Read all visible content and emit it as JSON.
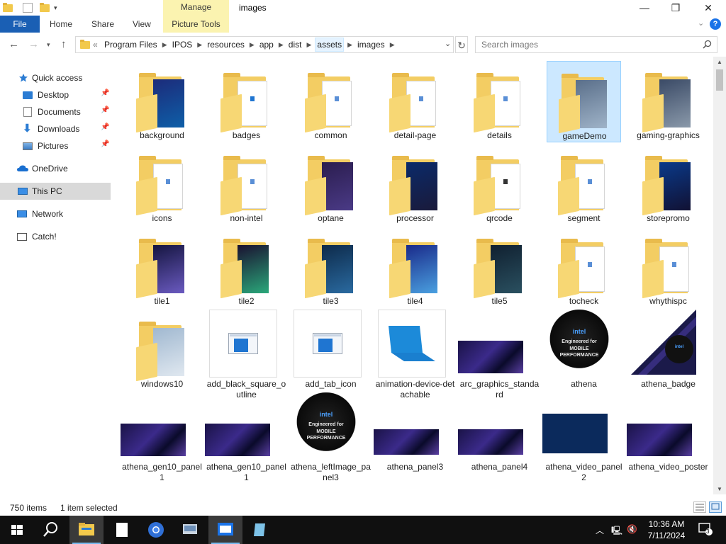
{
  "window": {
    "title": "images",
    "context_tab": "Manage",
    "minimize": "—",
    "maximize": "❐",
    "close": "✕"
  },
  "ribbon": {
    "file": "File",
    "tabs": [
      "Home",
      "Share",
      "View"
    ],
    "picture_tools": "Picture Tools"
  },
  "address": {
    "overflow": "«",
    "crumbs": [
      "Program Files",
      "IPOS",
      "resources",
      "app",
      "dist",
      "assets",
      "images"
    ],
    "highlighted_crumb": "assets"
  },
  "search": {
    "placeholder": "Search images"
  },
  "nav": {
    "quick_access": "Quick access",
    "desktop": "Desktop",
    "documents": "Documents",
    "downloads": "Downloads",
    "pictures": "Pictures",
    "onedrive": "OneDrive",
    "this_pc": "This PC",
    "network": "Network",
    "catch": "Catch!"
  },
  "items": [
    {
      "label": "background",
      "kind": "folder-img",
      "colors": [
        "#1c2b7a",
        "#0e5fa8"
      ]
    },
    {
      "label": "badges",
      "kind": "folder-doc",
      "colors": [
        "#1f75d1",
        "#ffffff"
      ]
    },
    {
      "label": "common",
      "kind": "folder-doc",
      "colors": [
        "#ffffff",
        "#ffffff"
      ]
    },
    {
      "label": "detail-page",
      "kind": "folder-doc",
      "colors": [
        "#ffffff",
        "#ffffff"
      ]
    },
    {
      "label": "details",
      "kind": "folder-doc",
      "colors": [
        "#ffffff",
        "#ffffff"
      ]
    },
    {
      "label": "gameDemo",
      "kind": "folder-img",
      "colors": [
        "#5a6f8a",
        "#9fb3c8"
      ],
      "selected": true
    },
    {
      "label": "gaming-graphics",
      "kind": "folder-img",
      "colors": [
        "#3a4a66",
        "#8a99aa"
      ]
    },
    {
      "label": "icons",
      "kind": "folder-doc",
      "colors": [
        "#ffffff",
        "#ffffff"
      ]
    },
    {
      "label": "non-intel",
      "kind": "folder-doc",
      "colors": [
        "#ffffff",
        "#ffffff"
      ]
    },
    {
      "label": "optane",
      "kind": "folder-img",
      "colors": [
        "#2b1d4f",
        "#4a3a86"
      ]
    },
    {
      "label": "processor",
      "kind": "folder-img",
      "colors": [
        "#0a2a6a",
        "#1a1a3a"
      ]
    },
    {
      "label": "qrcode",
      "kind": "folder-doc",
      "colors": [
        "#333333",
        "#ffffff"
      ]
    },
    {
      "label": "segment",
      "kind": "folder-doc",
      "colors": [
        "#ffffff",
        "#ffffff"
      ]
    },
    {
      "label": "storepromo",
      "kind": "folder-img",
      "colors": [
        "#0a3a8a",
        "#111133"
      ]
    },
    {
      "label": "tile1",
      "kind": "folder-img",
      "colors": [
        "#151540",
        "#6a5ac0"
      ]
    },
    {
      "label": "tile2",
      "kind": "folder-img",
      "colors": [
        "#1a1030",
        "#2aa87a"
      ]
    },
    {
      "label": "tile3",
      "kind": "folder-img",
      "colors": [
        "#0d2a4a",
        "#2a6aa0"
      ]
    },
    {
      "label": "tile4",
      "kind": "folder-img",
      "colors": [
        "#1a2a8a",
        "#4aa0e0"
      ]
    },
    {
      "label": "tile5",
      "kind": "folder-img",
      "colors": [
        "#102030",
        "#2a5060"
      ]
    },
    {
      "label": "tocheck",
      "kind": "folder-doc",
      "colors": [
        "#ffffff",
        "#dddddd"
      ]
    },
    {
      "label": "whythispc",
      "kind": "folder-doc",
      "colors": [
        "#ffffff",
        "#ffffff"
      ]
    },
    {
      "label": "windows10",
      "kind": "folder-img",
      "colors": [
        "#a0b8d0",
        "#e0e8f0"
      ]
    },
    {
      "label": "add_black_square_outline",
      "kind": "file-window"
    },
    {
      "label": "add_tab_icon",
      "kind": "file-window"
    },
    {
      "label": "animation-device-detachable",
      "kind": "file-laptop"
    },
    {
      "label": "arc_graphics_standard",
      "kind": "banner"
    },
    {
      "label": "athena",
      "kind": "badge-round"
    },
    {
      "label": "athena_badge",
      "kind": "badge-triangle"
    },
    {
      "label": "athena_gen10_panel1",
      "kind": "banner"
    },
    {
      "label": "athena_gen10_panel1",
      "kind": "banner"
    },
    {
      "label": "athena_leftImage_panel3",
      "kind": "badge-round"
    },
    {
      "label": "athena_panel3",
      "kind": "banner-thin"
    },
    {
      "label": "athena_panel4",
      "kind": "banner-thin"
    },
    {
      "label": "athena_video_panel2",
      "kind": "navy"
    },
    {
      "label": "athena_video_poster",
      "kind": "banner"
    }
  ],
  "badge_text": {
    "brand": "intel",
    "line1": "Engineered for",
    "line2": "MOBILE",
    "line3": "PERFORMANCE"
  },
  "status": {
    "count": "750 items",
    "selected": "1 item selected"
  },
  "tray": {
    "time": "10:36 AM",
    "date": "7/11/2024",
    "notifications": "3"
  },
  "colors": {
    "accent": "#1a5fb4",
    "selection": "#cce8ff",
    "context_tab": "#fbf3b0",
    "folder": "#f3cd63",
    "taskbar": "#101010"
  }
}
